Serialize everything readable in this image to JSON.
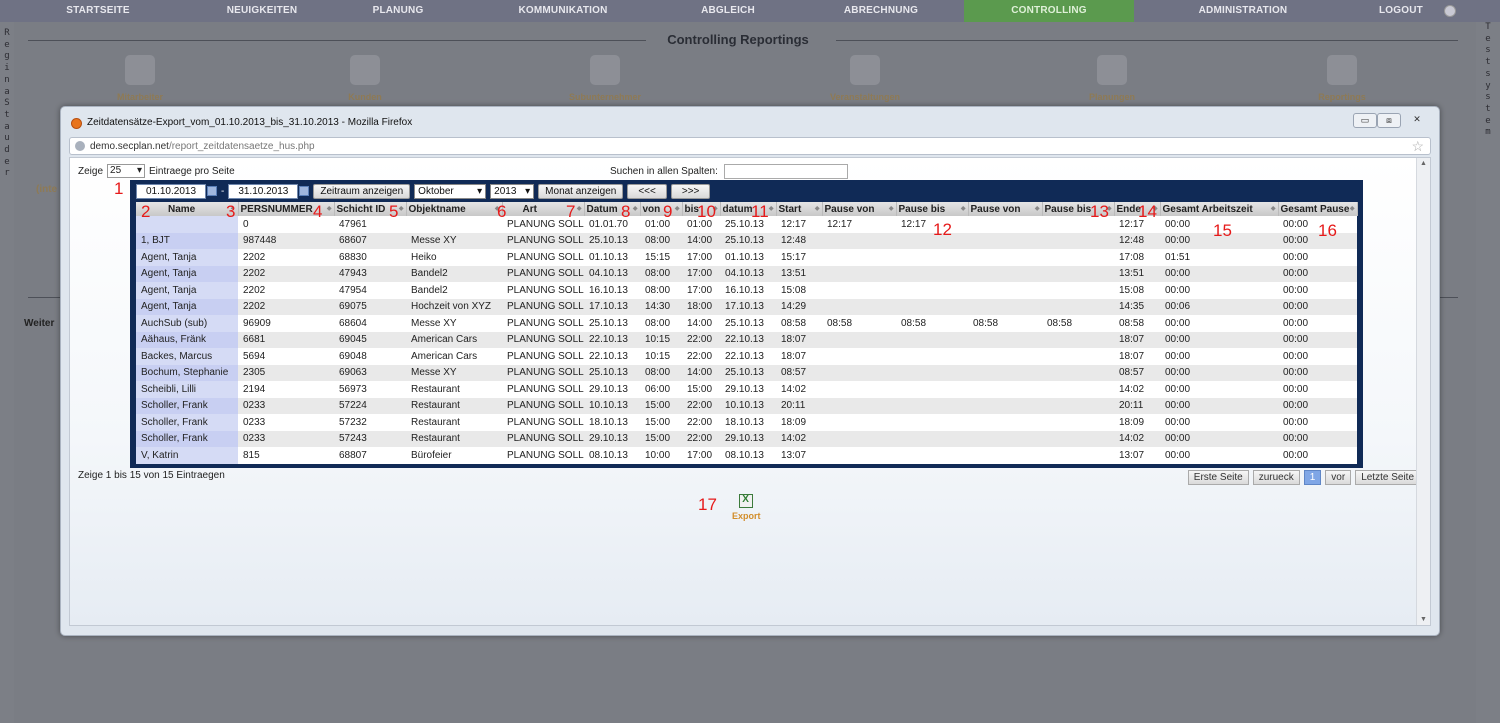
{
  "nav": {
    "items": [
      {
        "label": "STARTSEITE",
        "w": 196
      },
      {
        "label": "NEUIGKEITEN",
        "w": 132
      },
      {
        "label": "PLANUNG",
        "w": 140
      },
      {
        "label": "KOMMUNIKATION",
        "w": 190
      },
      {
        "label": "ABGLEICH",
        "w": 140
      },
      {
        "label": "ABRECHNUNG",
        "w": 166
      },
      {
        "label": "CONTROLLING",
        "w": 170,
        "active": true
      },
      {
        "label": "ADMINISTRATION",
        "w": 218
      },
      {
        "label": "LOGOUT",
        "w": 98
      }
    ]
  },
  "left_strip": "Regina Stauder",
  "right_strip": "Testsystem",
  "background": {
    "title": "Controlling Reportings",
    "icons": [
      "Mitarbeiter",
      "Kunden",
      "Subunternehmer",
      "Veranstaltungen",
      "Planungen",
      "Reportings"
    ],
    "left_fragment": "(inte",
    "weiter": "Weiter"
  },
  "firefox": {
    "title": "Zeitdatensätze-Export_vom_01.10.2013_bis_31.10.2013 - Mozilla Firefox",
    "url_host": "demo.secplan.net",
    "url_path": "/report_zeitdatensaetze_hus.php",
    "min": "▭",
    "max": "⧈",
    "close": "✕"
  },
  "controls": {
    "show_label": "Zeige",
    "page_length": "25",
    "entries_label": "Eintraege pro Seite",
    "search_label": "Suchen in allen Spalten:",
    "date_from": "01.10.2013",
    "date_sep": "-",
    "date_to": "31.10.2013",
    "range_button": "Zeitraum anzeigen",
    "month": "Oktober",
    "year": "2013",
    "month_button": "Monat anzeigen",
    "prev": "<<<",
    "next": ">>>"
  },
  "table": {
    "headers": [
      "Name",
      "PERSNUMMER",
      "Schicht ID",
      "Objektname",
      "Art",
      "Datum",
      "von",
      "bis",
      "datum",
      "Start",
      "Pause von",
      "Pause bis",
      "Pause von",
      "Pause bis",
      "Ende",
      "Gesamt Arbeitszeit",
      "Gesamt Pause"
    ],
    "rows": [
      [
        "",
        "0",
        "47961",
        "",
        "PLANUNG SOLL",
        "01.01.70",
        "01:00",
        "01:00",
        "25.10.13",
        "12:17",
        "12:17",
        "12:17",
        "",
        "",
        "12:17",
        "00:00",
        "00:00"
      ],
      [
        "1, BJT",
        "987448",
        "68607",
        "Messe XY",
        "PLANUNG SOLL",
        "25.10.13",
        "08:00",
        "14:00",
        "25.10.13",
        "12:48",
        "",
        "",
        "",
        "",
        "12:48",
        "00:00",
        "00:00"
      ],
      [
        "Agent, Tanja",
        "2202",
        "68830",
        "Heiko",
        "PLANUNG SOLL",
        "01.10.13",
        "15:15",
        "17:00",
        "01.10.13",
        "15:17",
        "",
        "",
        "",
        "",
        "17:08",
        "01:51",
        "00:00"
      ],
      [
        "Agent, Tanja",
        "2202",
        "47943",
        "Bandel2",
        "PLANUNG SOLL",
        "04.10.13",
        "08:00",
        "17:00",
        "04.10.13",
        "13:51",
        "",
        "",
        "",
        "",
        "13:51",
        "00:00",
        "00:00"
      ],
      [
        "Agent, Tanja",
        "2202",
        "47954",
        "Bandel2",
        "PLANUNG SOLL",
        "16.10.13",
        "08:00",
        "17:00",
        "16.10.13",
        "15:08",
        "",
        "",
        "",
        "",
        "15:08",
        "00:00",
        "00:00"
      ],
      [
        "Agent, Tanja",
        "2202",
        "69075",
        "Hochzeit von XYZ",
        "PLANUNG SOLL",
        "17.10.13",
        "14:30",
        "18:00",
        "17.10.13",
        "14:29",
        "",
        "",
        "",
        "",
        "14:35",
        "00:06",
        "00:00"
      ],
      [
        "AuchSub (sub)",
        "96909",
        "68604",
        "Messe XY",
        "PLANUNG SOLL",
        "25.10.13",
        "08:00",
        "14:00",
        "25.10.13",
        "08:58",
        "08:58",
        "08:58",
        "08:58",
        "08:58",
        "08:58",
        "00:00",
        "00:00"
      ],
      [
        "Aähaus, Fränk",
        "6681",
        "69045",
        "American Cars",
        "PLANUNG SOLL",
        "22.10.13",
        "10:15",
        "22:00",
        "22.10.13",
        "18:07",
        "",
        "",
        "",
        "",
        "18:07",
        "00:00",
        "00:00"
      ],
      [
        "Backes, Marcus",
        "5694",
        "69048",
        "American Cars",
        "PLANUNG SOLL",
        "22.10.13",
        "10:15",
        "22:00",
        "22.10.13",
        "18:07",
        "",
        "",
        "",
        "",
        "18:07",
        "00:00",
        "00:00"
      ],
      [
        "Bochum, Stephanie",
        "2305",
        "69063",
        "Messe XY",
        "PLANUNG SOLL",
        "25.10.13",
        "08:00",
        "14:00",
        "25.10.13",
        "08:57",
        "",
        "",
        "",
        "",
        "08:57",
        "00:00",
        "00:00"
      ],
      [
        "Scheibli, Lilli",
        "2194",
        "56973",
        "Restaurant",
        "PLANUNG SOLL",
        "29.10.13",
        "06:00",
        "15:00",
        "29.10.13",
        "14:02",
        "",
        "",
        "",
        "",
        "14:02",
        "00:00",
        "00:00"
      ],
      [
        "Scholler, Frank",
        "0233",
        "57224",
        "Restaurant",
        "PLANUNG SOLL",
        "10.10.13",
        "15:00",
        "22:00",
        "10.10.13",
        "20:11",
        "",
        "",
        "",
        "",
        "20:11",
        "00:00",
        "00:00"
      ],
      [
        "Scholler, Frank",
        "0233",
        "57232",
        "Restaurant",
        "PLANUNG SOLL",
        "18.10.13",
        "15:00",
        "22:00",
        "18.10.13",
        "18:09",
        "",
        "",
        "",
        "",
        "18:09",
        "00:00",
        "00:00"
      ],
      [
        "Scholler, Frank",
        "0233",
        "57243",
        "Restaurant",
        "PLANUNG SOLL",
        "29.10.13",
        "15:00",
        "22:00",
        "29.10.13",
        "14:02",
        "",
        "",
        "",
        "",
        "14:02",
        "00:00",
        "00:00"
      ],
      [
        "V, Katrin",
        "815",
        "68807",
        "Bürofeier",
        "PLANUNG SOLL",
        "08.10.13",
        "10:00",
        "17:00",
        "08.10.13",
        "13:07",
        "",
        "",
        "",
        "",
        "13:07",
        "00:00",
        "00:00"
      ]
    ]
  },
  "footer": {
    "info": "Zeige 1 bis 15 von 15 Eintraegen",
    "first": "Erste Seite",
    "prev": "zurueck",
    "page": "1",
    "next": "vor",
    "last": "Letzte Seite",
    "export": "Export"
  },
  "annotations": [
    "1",
    "2",
    "3",
    "4",
    "5",
    "6",
    "7",
    "8",
    "9",
    "10",
    "11",
    "12",
    "13",
    "14",
    "15",
    "16",
    "17"
  ]
}
